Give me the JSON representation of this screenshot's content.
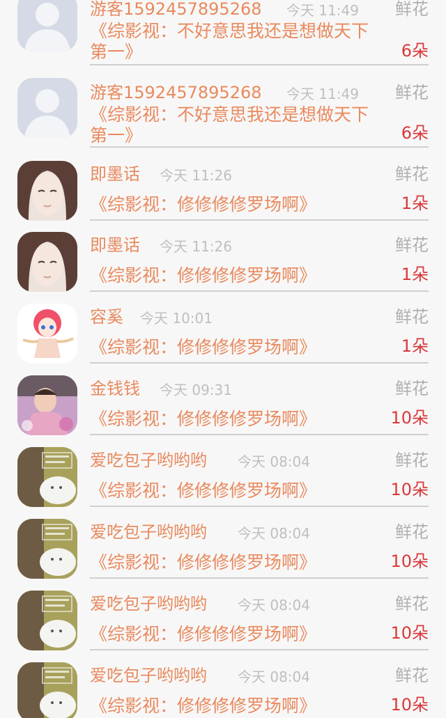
{
  "records": [
    {
      "user": "游客1592457895268",
      "time": "今天 11:49",
      "gift_label": "鲜花",
      "work": "《综影视：不好意思我还是想做天下第一》",
      "count": "6朵",
      "avatar": "default-avatar"
    },
    {
      "user": "游客1592457895268",
      "time": "今天 11:49",
      "gift_label": "鲜花",
      "work": "《综影视：不好意思我还是想做天下第一》",
      "count": "6朵",
      "avatar": "default-avatar"
    },
    {
      "user": "即墨话",
      "time": "今天 11:26",
      "gift_label": "鲜花",
      "work": "《综影视：修修修修罗场啊》",
      "count": "1朵",
      "avatar": "woman-portrait-avatar"
    },
    {
      "user": "即墨话",
      "time": "今天 11:26",
      "gift_label": "鲜花",
      "work": "《综影视：修修修修罗场啊》",
      "count": "1朵",
      "avatar": "woman-portrait-avatar"
    },
    {
      "user": "容奚",
      "time": "今天 10:01",
      "gift_label": "鲜花",
      "work": "《综影视：修修修修罗场啊》",
      "count": "1朵",
      "avatar": "anime-girl-avatar"
    },
    {
      "user": "金钱钱",
      "time": "今天 09:31",
      "gift_label": "鲜花",
      "work": "《综影视：修修修修罗场啊》",
      "count": "10朵",
      "avatar": "baby-photo-avatar"
    },
    {
      "user": "爱吃包子哟哟哟",
      "time": "今天 08:04",
      "gift_label": "鲜花",
      "work": "《综影视：修修修修罗场啊》",
      "count": "10朵",
      "avatar": "cats-meme-avatar"
    },
    {
      "user": "爱吃包子哟哟哟",
      "time": "今天 08:04",
      "gift_label": "鲜花",
      "work": "《综影视：修修修修罗场啊》",
      "count": "10朵",
      "avatar": "cats-meme-avatar"
    },
    {
      "user": "爱吃包子哟哟哟",
      "time": "今天 08:04",
      "gift_label": "鲜花",
      "work": "《综影视：修修修修罗场啊》",
      "count": "10朵",
      "avatar": "cats-meme-avatar"
    },
    {
      "user": "爱吃包子哟哟哟",
      "time": "今天 08:04",
      "gift_label": "鲜花",
      "work": "《综影视：修修修修罗场啊》",
      "count": "10朵",
      "avatar": "cats-meme-avatar"
    }
  ]
}
